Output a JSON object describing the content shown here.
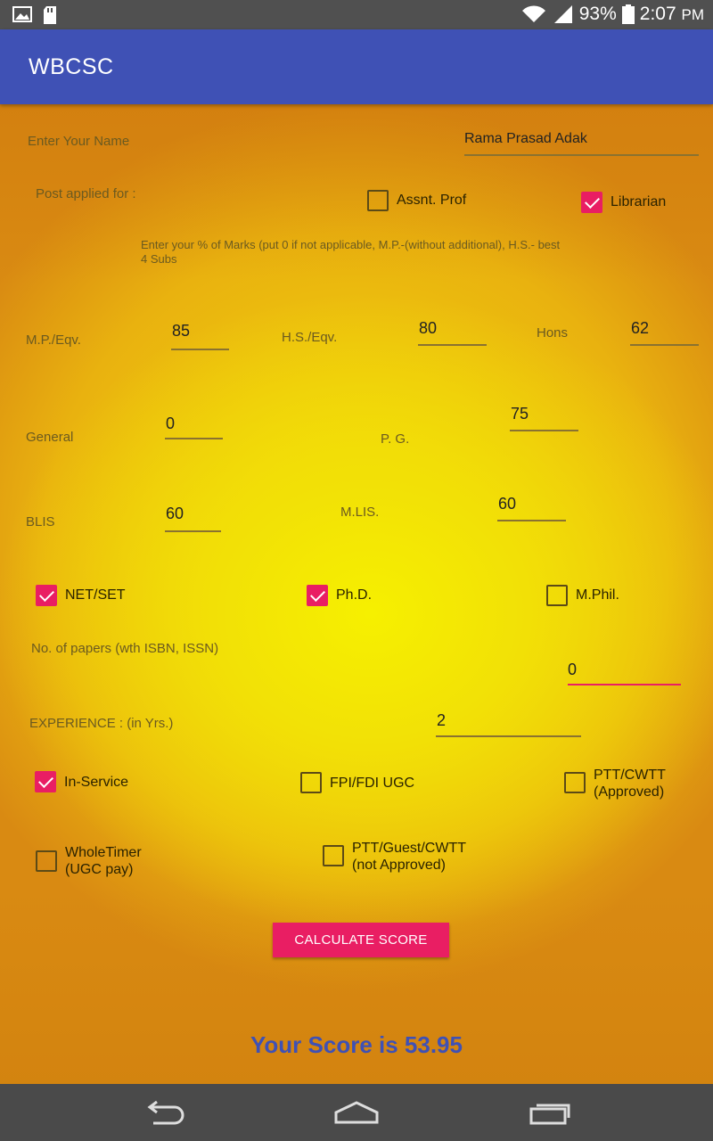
{
  "status_bar": {
    "battery": "93%",
    "time": "2:07",
    "time_suffix": "PM",
    "icons": [
      "image-icon",
      "sd-card-icon",
      "wifi-icon",
      "signal-icon",
      "battery-icon"
    ]
  },
  "app": {
    "title": "WBCSC",
    "accent_color": "#3F51B5",
    "button_color": "#E91E63"
  },
  "form": {
    "name_label": "Enter Your Name",
    "name_value": "Rama Prasad Adak",
    "post_label": "Post applied for :",
    "post_options": [
      {
        "label": "Assnt. Prof",
        "checked": false
      },
      {
        "label": "Librarian",
        "checked": true
      }
    ],
    "hint": "Enter your % of Marks (put 0 if not applicable, M.P.-(without additional), H.S.- best 4 Subs",
    "marks": {
      "mp_label": "M.P./Eqv.",
      "mp_value": "85",
      "hs_label": "H.S./Eqv.",
      "hs_value": "80",
      "hons_label": "Hons",
      "hons_value": "62",
      "general_label": "General",
      "general_value": "0",
      "pg_label": "P. G.",
      "pg_value": "75",
      "blis_label": "BLIS",
      "blis_value": "60",
      "mlis_label": "M.LIS.",
      "mlis_value": "60"
    },
    "qualifications": [
      {
        "label": "NET/SET",
        "checked": true
      },
      {
        "label": "Ph.D.",
        "checked": true
      },
      {
        "label": "M.Phil.",
        "checked": false
      }
    ],
    "papers_label": "No. of papers (wth ISBN, ISSN)",
    "papers_value": "0",
    "experience_label": "EXPERIENCE : (in Yrs.)",
    "experience_value": "2",
    "service": [
      {
        "label": "In-Service",
        "checked": true
      },
      {
        "label": "FPI/FDI UGC",
        "checked": false
      },
      {
        "label_line1": "PTT/CWTT",
        "label_line2": "(Approved)",
        "checked": false
      },
      {
        "label_line1": "WholeTimer",
        "label_line2": "(UGC pay)",
        "checked": false
      },
      {
        "label_line1": "PTT/Guest/CWTT",
        "label_line2": "(not Approved)",
        "checked": false
      }
    ],
    "calculate_label": "CALCULATE SCORE",
    "score_text": "Your Score is 53.95"
  },
  "nav_bar": {
    "icons": [
      "back-icon",
      "home-icon",
      "recents-icon"
    ]
  }
}
